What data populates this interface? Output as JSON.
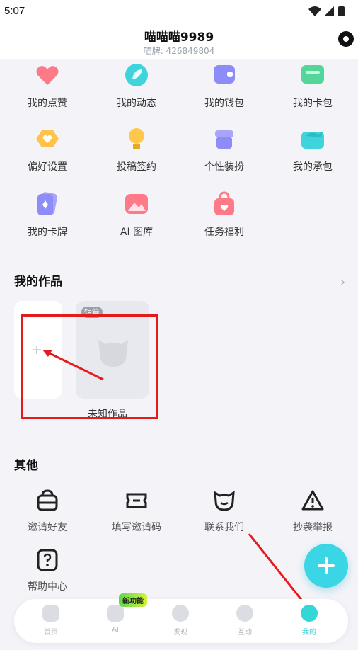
{
  "status_bar": {
    "time": "5:07"
  },
  "profile": {
    "username": "喵喵喵9989",
    "user_id": "喵牌: 426849804"
  },
  "menu_grid": [
    {
      "label": "我的点赞",
      "icon": "heart-icon",
      "color": "#ff6f80"
    },
    {
      "label": "我的动态",
      "icon": "leaf-icon",
      "color": "#3fd4dc"
    },
    {
      "label": "我的钱包",
      "icon": "wallet-icon",
      "color": "#8e8cf8"
    },
    {
      "label": "我的卡包",
      "icon": "card-holder-icon",
      "color": "#52d69a"
    },
    {
      "label": "偏好设置",
      "icon": "preference-icon",
      "color": "#ffc24a"
    },
    {
      "label": "投稿签约",
      "icon": "lightbulb-icon",
      "color": "#ffc84a"
    },
    {
      "label": "个性装扮",
      "icon": "shop-icon",
      "color": "#8e8cf8"
    },
    {
      "label": "我的承包",
      "icon": "fish-icon",
      "color": "#3fd4dc"
    },
    {
      "label": "我的卡牌",
      "icon": "cards-icon",
      "color": "#8e8cf8"
    },
    {
      "label": "AI 图库",
      "icon": "gallery-icon",
      "color": "#ff7a88"
    },
    {
      "label": "任务福利",
      "icon": "gift-bag-icon",
      "color": "#ff7a88"
    }
  ],
  "works": {
    "title": "我的作品",
    "items": [
      {
        "tag": "短篇",
        "title": "未知作品"
      }
    ]
  },
  "other": {
    "title": "其他",
    "items": [
      {
        "label": "邀请好友",
        "icon": "invite-icon"
      },
      {
        "label": "填写邀请码",
        "icon": "ticket-icon"
      },
      {
        "label": "联系我们",
        "icon": "cat-face-icon"
      },
      {
        "label": "抄袭举报",
        "icon": "warning-icon"
      },
      {
        "label": "帮助中心",
        "icon": "help-icon"
      }
    ]
  },
  "tabbar": {
    "tabs": [
      {
        "label": "首页",
        "icon": "home-icon",
        "active": false
      },
      {
        "label": "AI",
        "icon": "ai-icon",
        "active": false
      },
      {
        "label": "发现",
        "icon": "discover-icon",
        "active": false
      },
      {
        "label": "互动",
        "icon": "chat-icon",
        "active": false
      },
      {
        "label": "我的",
        "icon": "profile-icon",
        "active": true
      }
    ],
    "new_feature_badge": "新功能"
  }
}
